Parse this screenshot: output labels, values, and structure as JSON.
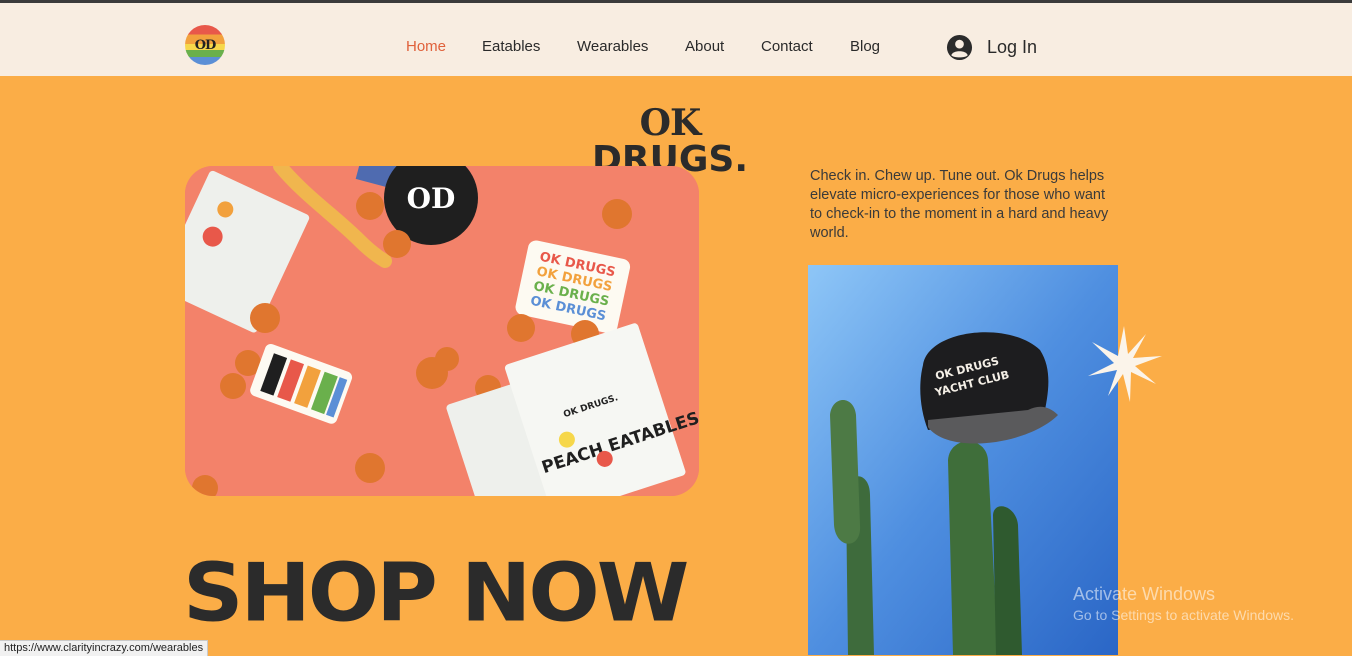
{
  "header": {
    "logo_text": "OD",
    "nav": [
      {
        "label": "Home",
        "active": true
      },
      {
        "label": "Eatables",
        "active": false
      },
      {
        "label": "Wearables",
        "active": false
      },
      {
        "label": "About",
        "active": false
      },
      {
        "label": "Contact",
        "active": false
      },
      {
        "label": "Blog",
        "active": false
      }
    ],
    "login_label": "Log In"
  },
  "hero": {
    "brand_line1": "OK",
    "brand_line2": "DRUGS.",
    "tagline": "Check in. Chew up. Tune out. Ok Drugs helps elevate micro-experiences for those who want to check-in to the moment in a hard and heavy world.",
    "cta": "SHOP NOW",
    "photo1_texts": {
      "sticker_circle": "OD",
      "sticker_rainbow": [
        "OK DRUGS",
        "OK DRUGS",
        "OK DRUGS",
        "OK DRUGS"
      ],
      "pouch_brand": "OK DRUGS.",
      "pouch_product": "PEACH EATABLES"
    },
    "photo2_texts": {
      "hat_line1": "OK DRUGS",
      "hat_line2": "YACHT CLUB"
    }
  },
  "overlay": {
    "activate_title": "Activate Windows",
    "activate_sub": "Go to Settings to activate Windows."
  },
  "statusbar": {
    "url": "https://www.clarityincrazy.com/wearables"
  },
  "colors": {
    "page_bg": "#fbad47",
    "header_bg": "#f8ede1",
    "nav_active": "#e0613b",
    "text_dark": "#2b2b2b"
  }
}
